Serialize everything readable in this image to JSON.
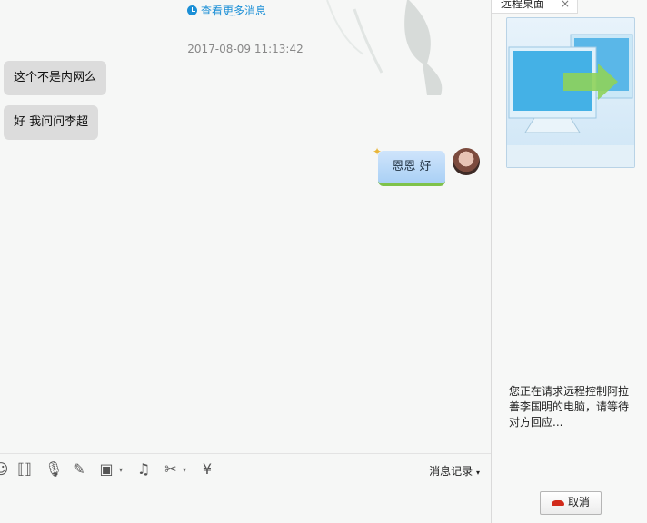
{
  "chat": {
    "more_messages": "查看更多消息",
    "timestamp": "2017-08-09 11:13:42",
    "messages_left": [
      "这个不是内网么",
      "好 我问问李超"
    ],
    "message_right": "恩恩 好"
  },
  "toolbar": {
    "history_label": "消息记录"
  },
  "side": {
    "tab_label": "远程桌面",
    "close_glyph": "×",
    "status_text": "您正在请求远程控制阿拉善李国明的电脑，请等待对方回应...",
    "cancel_label": "取消"
  }
}
